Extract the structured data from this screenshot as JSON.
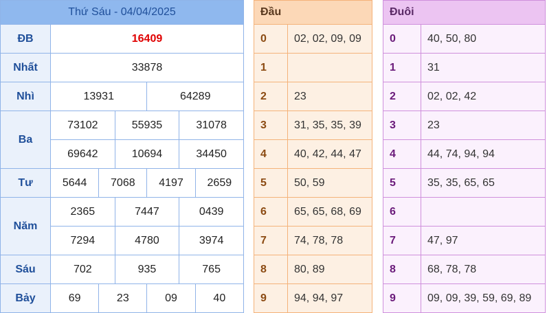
{
  "results": {
    "header": "Thứ Sáu - 04/04/2025",
    "rows": [
      {
        "label": "ĐB",
        "values": [
          "16409"
        ]
      },
      {
        "label": "Nhất",
        "values": [
          "33878"
        ]
      },
      {
        "label": "Nhì",
        "values": [
          "13931",
          "64289"
        ]
      },
      {
        "label": "Ba",
        "values": [
          "73102",
          "55935",
          "31078",
          "69642",
          "10694",
          "34450"
        ]
      },
      {
        "label": "Tư",
        "values": [
          "5644",
          "7068",
          "4197",
          "2659"
        ]
      },
      {
        "label": "Năm",
        "values": [
          "2365",
          "7447",
          "0439",
          "7294",
          "4780",
          "3974"
        ]
      },
      {
        "label": "Sáu",
        "values": [
          "702",
          "935",
          "765"
        ]
      },
      {
        "label": "Bảy",
        "values": [
          "69",
          "23",
          "09",
          "40"
        ]
      }
    ],
    "special_color": "#e00000"
  },
  "dau": {
    "title": "Đầu",
    "rows": [
      {
        "k": "0",
        "v": "02, 02, 09, 09"
      },
      {
        "k": "1",
        "v": ""
      },
      {
        "k": "2",
        "v": "23"
      },
      {
        "k": "3",
        "v": "31, 35, 35, 39"
      },
      {
        "k": "4",
        "v": "40, 42, 44, 47"
      },
      {
        "k": "5",
        "v": "50, 59"
      },
      {
        "k": "6",
        "v": "65, 65, 68, 69"
      },
      {
        "k": "7",
        "v": "74, 78, 78"
      },
      {
        "k": "8",
        "v": "80, 89"
      },
      {
        "k": "9",
        "v": "94, 94, 97"
      }
    ]
  },
  "duoi": {
    "title": "Đuôi",
    "rows": [
      {
        "k": "0",
        "v": "40, 50, 80"
      },
      {
        "k": "1",
        "v": "31"
      },
      {
        "k": "2",
        "v": "02, 02, 42"
      },
      {
        "k": "3",
        "v": "23"
      },
      {
        "k": "4",
        "v": "44, 74, 94, 94"
      },
      {
        "k": "5",
        "v": "35, 35, 65, 65"
      },
      {
        "k": "6",
        "v": ""
      },
      {
        "k": "7",
        "v": "47, 97"
      },
      {
        "k": "8",
        "v": "68, 78, 78"
      },
      {
        "k": "9",
        "v": "09, 09, 39, 59, 69, 89"
      }
    ]
  }
}
